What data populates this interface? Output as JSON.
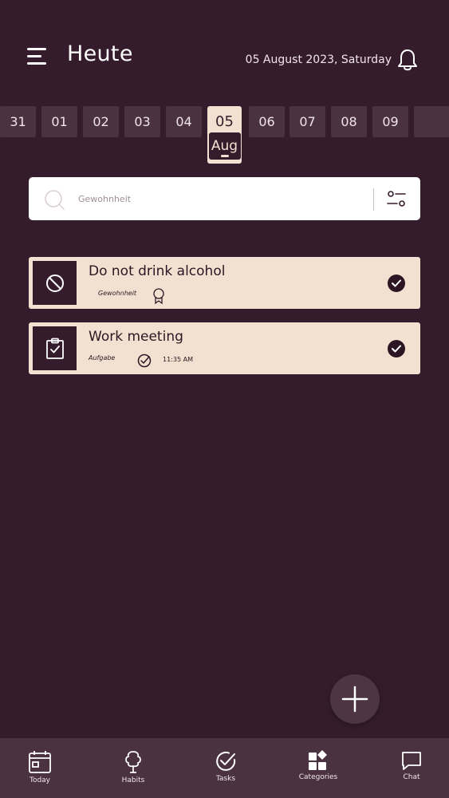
{
  "header": {
    "title": "Heute",
    "date": "05 August 2023, Saturday"
  },
  "date_strip": {
    "days": [
      "31",
      "01",
      "02",
      "03",
      "04",
      "05",
      "06",
      "07",
      "08",
      "09"
    ],
    "selected_day": "05",
    "selected_month": "Aug"
  },
  "search": {
    "placeholder": "Gewohnheit"
  },
  "items": [
    {
      "title": "Do not drink alcohol",
      "type": "Gewohnheit",
      "icon": "ban-icon",
      "completed": true
    },
    {
      "title": "Work meeting",
      "type": "Aufgabe",
      "icon": "clipboard-check-icon",
      "time": "11:35 AM",
      "completed": true
    }
  ],
  "nav": [
    {
      "label": "Today",
      "icon": "calendar-icon"
    },
    {
      "label": "Habits",
      "icon": "tree-icon"
    },
    {
      "label": "Tasks",
      "icon": "check-circle-icon"
    },
    {
      "label": "Categories",
      "icon": "grid-icon"
    },
    {
      "label": "Chat",
      "icon": "chat-icon"
    }
  ],
  "colors": {
    "background": "#351c2c",
    "card": "#f2e0d0",
    "nav_bg": "#4a3241",
    "day_bg": "#4a3241"
  }
}
